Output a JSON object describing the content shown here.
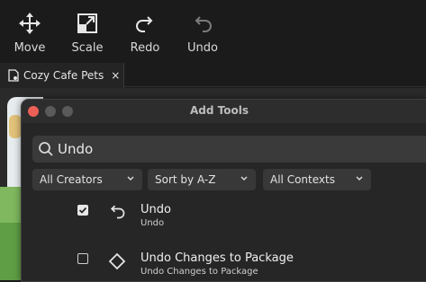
{
  "toolbar": {
    "move_label": "Move",
    "scale_label": "Scale",
    "redo_label": "Redo",
    "undo_label": "Undo"
  },
  "tab": {
    "title": "Cozy Cafe Pets",
    "close": "×"
  },
  "dialog": {
    "title": "Add Tools",
    "search_value": "Undo",
    "filters": [
      {
        "label": "All Creators"
      },
      {
        "label": "Sort by A-Z"
      },
      {
        "label": "All Contexts"
      }
    ],
    "results": [
      {
        "name": "Undo",
        "subtitle": "Undo",
        "checked": true,
        "icon": "undo-icon"
      },
      {
        "name": "Undo Changes to Package",
        "subtitle": "Undo Changes to Package",
        "checked": false,
        "icon": "diamond-icon"
      }
    ]
  },
  "colors": {
    "background": "#1b1b1b",
    "panel": "#262626",
    "close_button": "#ec5f57",
    "field": "#3a3a3a"
  }
}
